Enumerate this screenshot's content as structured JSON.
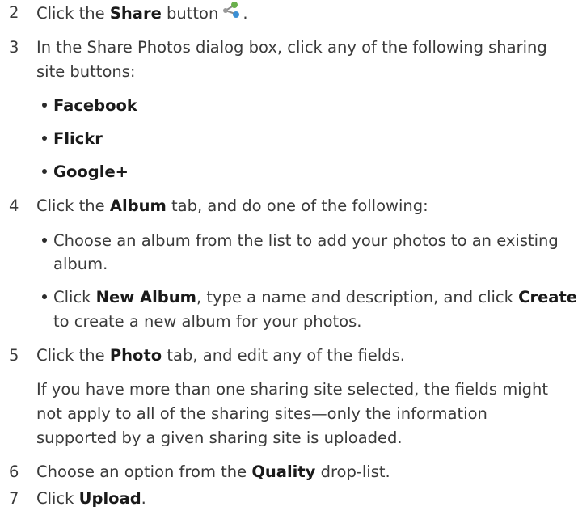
{
  "steps": {
    "s2": {
      "num": "2",
      "pre": "Click the ",
      "bold": "Share",
      "post": " button",
      "end": "."
    },
    "s3": {
      "num": "3",
      "line1": "In the Share Photos dialog box, click any of the following sharing",
      "line2": "site buttons:",
      "bullets": [
        "Facebook",
        "Flickr",
        "Google+"
      ]
    },
    "s4": {
      "num": "4",
      "pre": "Click the ",
      "bold": "Album",
      "post": " tab, and do one of the following:",
      "b1_line1": "Choose an album from the list to add your photos to an existing",
      "b1_line2": "album.",
      "b2_pre": "Click ",
      "b2_bold1": "New Album",
      "b2_mid": ", type a name and description, and click ",
      "b2_bold2": "Create",
      "b2_line2": "to create a new album for your photos."
    },
    "s5": {
      "num": "5",
      "pre": "Click the ",
      "bold": "Photo",
      "post": " tab, and edit any of the fields.",
      "note_line1": "If you have more than one sharing site selected, the fields might",
      "note_line2": "not apply to all of the sharing sites—only the information",
      "note_line3": "supported by a given sharing site is uploaded."
    },
    "s6": {
      "num": "6",
      "pre": "Choose an option from the ",
      "bold": "Quality",
      "post": " drop-list."
    },
    "s7": {
      "num": "7",
      "pre": "Click ",
      "bold": "Upload",
      "post": "."
    }
  },
  "icons": {
    "share": "share-icon",
    "share_colors": {
      "top": "#6ab04c",
      "bottom": "#3b8fd4",
      "left": "#8a8a8a"
    }
  }
}
